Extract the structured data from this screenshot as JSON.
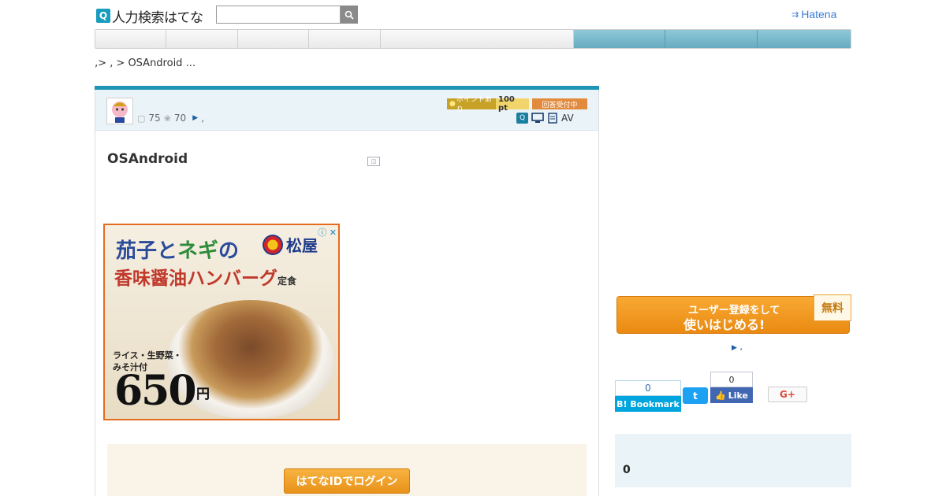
{
  "header": {
    "logo_text": "人力検索はてな",
    "search_placeholder": "",
    "brand": "Hatena"
  },
  "nav": {
    "left_tab_count": 5,
    "right_tab_count": 3
  },
  "breadcrumb": "‚> ‚ > OSAndroid ...",
  "question": {
    "title": "OSAndroid",
    "answers_count": "75",
    "stars_count": "70",
    "more_text": "‚",
    "point_label": "ポイントあり",
    "points": "100 pt",
    "status": "回答受付中",
    "category_text": "AV"
  },
  "ad": {
    "headline_1a": "茄子と",
    "headline_1b": "ネギ",
    "headline_1c": "の",
    "brand": "松屋",
    "headline_2": "香味醤油ハンバーグ",
    "headline_2_suffix": "定食",
    "sides_1": "ライス・生野菜・",
    "sides_2": "みそ汁付",
    "price": "650",
    "yen": "円"
  },
  "login": {
    "button_label": "はてなIDでログイン"
  },
  "sidebar": {
    "register_line1": "ユーザー登録をして",
    "register_line2": "使いはじめる!",
    "free_badge": "無料",
    "register_link": "‚",
    "bookmark_count": "0",
    "bookmark_label": "B! Bookmark",
    "twitter_label": "t",
    "like_count": "0",
    "like_label": "Like",
    "gplus_label": "G+",
    "info_count": "0"
  },
  "colors": {
    "accent_blue": "#1f95b5",
    "nav_blue": "#68abc0",
    "orange": "#e8921a"
  }
}
